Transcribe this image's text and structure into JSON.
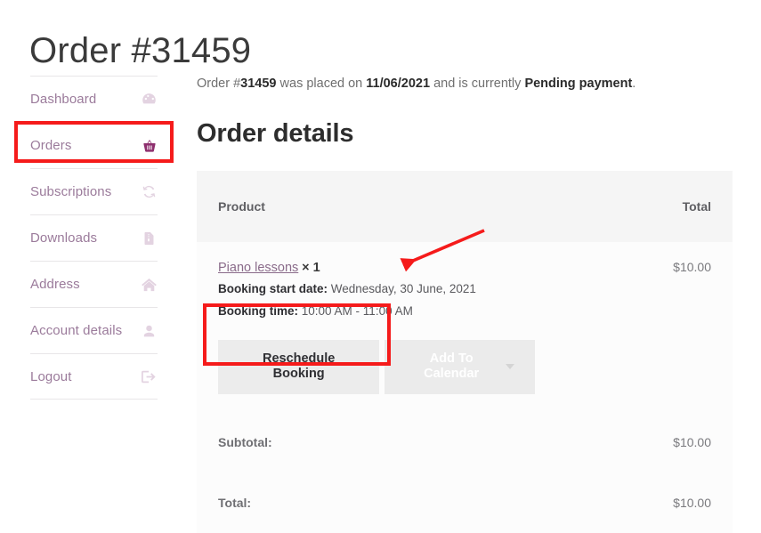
{
  "page": {
    "title": "Order #31459"
  },
  "sidebar": {
    "items": [
      {
        "label": "Dashboard",
        "icon": "dashboard-gauge-icon",
        "active": false
      },
      {
        "label": "Orders",
        "icon": "basket-icon",
        "active": true
      },
      {
        "label": "Subscriptions",
        "icon": "refresh-sync-icon",
        "active": false
      },
      {
        "label": "Downloads",
        "icon": "file-download-icon",
        "active": false
      },
      {
        "label": "Address",
        "icon": "home-icon",
        "active": false
      },
      {
        "label": "Account details",
        "icon": "user-icon",
        "active": false
      },
      {
        "label": "Logout",
        "icon": "logout-arrow-icon",
        "active": false
      }
    ]
  },
  "main": {
    "status_text": {
      "prefix": "Order #",
      "order_number": "31459",
      "middle": " was placed on ",
      "date": "11/06/2021",
      "connector": " and is currently ",
      "status": "Pending payment",
      "suffix": "."
    },
    "section_title": "Order details",
    "table": {
      "headers": {
        "product": "Product",
        "total": "Total"
      },
      "row": {
        "product_name": "Piano lessons",
        "quantity": "× 1",
        "booking_start_label": "Booking start date:",
        "booking_start_value": "Wednesday, 30 June, 2021",
        "booking_time_label": "Booking time:",
        "booking_time_value": "10:00 AM - 11:00 AM",
        "line_total": "$10.00"
      },
      "buttons": {
        "reschedule": "Reschedule Booking",
        "add_to_calendar": "Add To Calendar"
      },
      "footer": [
        {
          "label": "Subtotal:",
          "value": "$10.00"
        },
        {
          "label": "Total:",
          "value": "$10.00"
        }
      ]
    }
  },
  "annotations": {
    "highlight_color": "#f51b1b",
    "boxes": [
      {
        "name": "orders-sidebar-highlight"
      },
      {
        "name": "reschedule-button-highlight"
      }
    ],
    "arrow": {
      "name": "arrow-pointing-to-booking-start-date"
    }
  },
  "colors": {
    "sidebar_link": "#9b7b9b",
    "active_icon": "#8e2f6e",
    "table_header_bg": "#f5f5f5",
    "table_row_bg": "#fcfcfc",
    "product_link": "#8a6b8a"
  }
}
